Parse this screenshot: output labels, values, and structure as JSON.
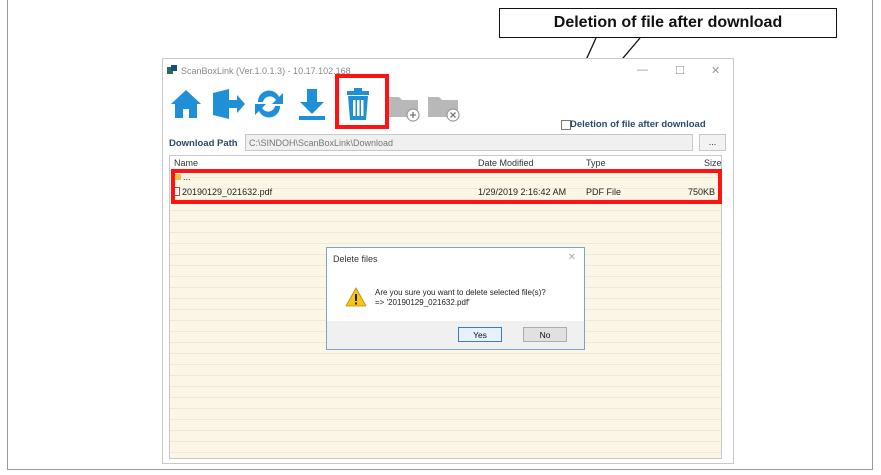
{
  "callout": {
    "text": "Deletion of file after download"
  },
  "window": {
    "title": "ScanBoxLink (Ver.1.0.1.3) - 10.17.102.168",
    "controls": {
      "minimize": "—",
      "maximize": "☐",
      "close": "✕"
    }
  },
  "toolbar": {
    "buttons": [
      {
        "icon": "home-icon"
      },
      {
        "icon": "exit-icon"
      },
      {
        "icon": "refresh-icon"
      },
      {
        "icon": "download-icon"
      },
      {
        "icon": "trash-icon",
        "highlighted": true
      },
      {
        "icon": "add-folder-icon"
      },
      {
        "icon": "remove-folder-icon"
      }
    ],
    "delete_after_download_label": "Deletion of file after download"
  },
  "download_path": {
    "label": "Download Path",
    "value": "C:\\SINDOH\\ScanBoxLink\\Download",
    "browse_label": "..."
  },
  "file_list": {
    "columns": {
      "name": "Name",
      "date": "Date Modified",
      "type": "Type",
      "size": "Size"
    },
    "parent_row": {
      "name": "..."
    },
    "rows": [
      {
        "name": "20190129_021632.pdf",
        "date": "1/29/2019 2:16:42 AM",
        "type": "PDF File",
        "size": "750KB"
      }
    ]
  },
  "dialog": {
    "title": "Delete files",
    "close": "✕",
    "message_line1": "Are you sure you want to delete selected file(s)?",
    "message_line2": "=> '20190129_021632.pdf'",
    "yes_label": "Yes",
    "no_label": "No"
  },
  "colors": {
    "toolbar_icon": "#1f8fd6",
    "highlight": "#ff1212",
    "list_bg": "#fbf6e6"
  }
}
